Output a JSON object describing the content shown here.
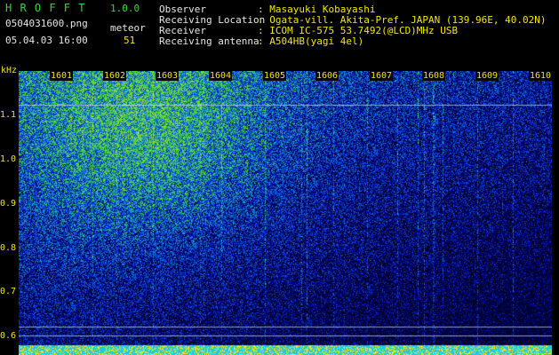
{
  "app": {
    "title": "H R O F F T",
    "version": "1.0.0"
  },
  "file": {
    "name": "0504031600.png",
    "datetime": "05.04.03 16:00"
  },
  "meteor": {
    "label": "meteor",
    "count": "51"
  },
  "info": {
    "rows": [
      {
        "label": "Observer",
        "value": ": Masayuki Kobayashi"
      },
      {
        "label": "Receiving Location",
        "value": ": Ogata-vill. Akita-Pref. JAPAN (139.96E, 40.02N)"
      },
      {
        "label": "Receiver",
        "value": ": ICOM IC-575 53.7492(@LCD)MHz USB"
      },
      {
        "label": "Receiving antenna",
        "value": ": A504HB(yagi 4el)"
      }
    ]
  },
  "axis": {
    "y_unit": "kHz",
    "y_ticks": [
      "1.1",
      "1.0",
      "0.9",
      "0.8",
      "0.7",
      "0.6"
    ],
    "x_ticks": [
      "1601",
      "1602",
      "1603",
      "1604",
      "1605",
      "1606",
      "1607",
      "1608",
      "1609",
      "1610"
    ]
  },
  "colors": {
    "title": "#3fd03f",
    "labels": "#e6e6e6",
    "values": "#f2e600",
    "background": "#000000"
  }
}
